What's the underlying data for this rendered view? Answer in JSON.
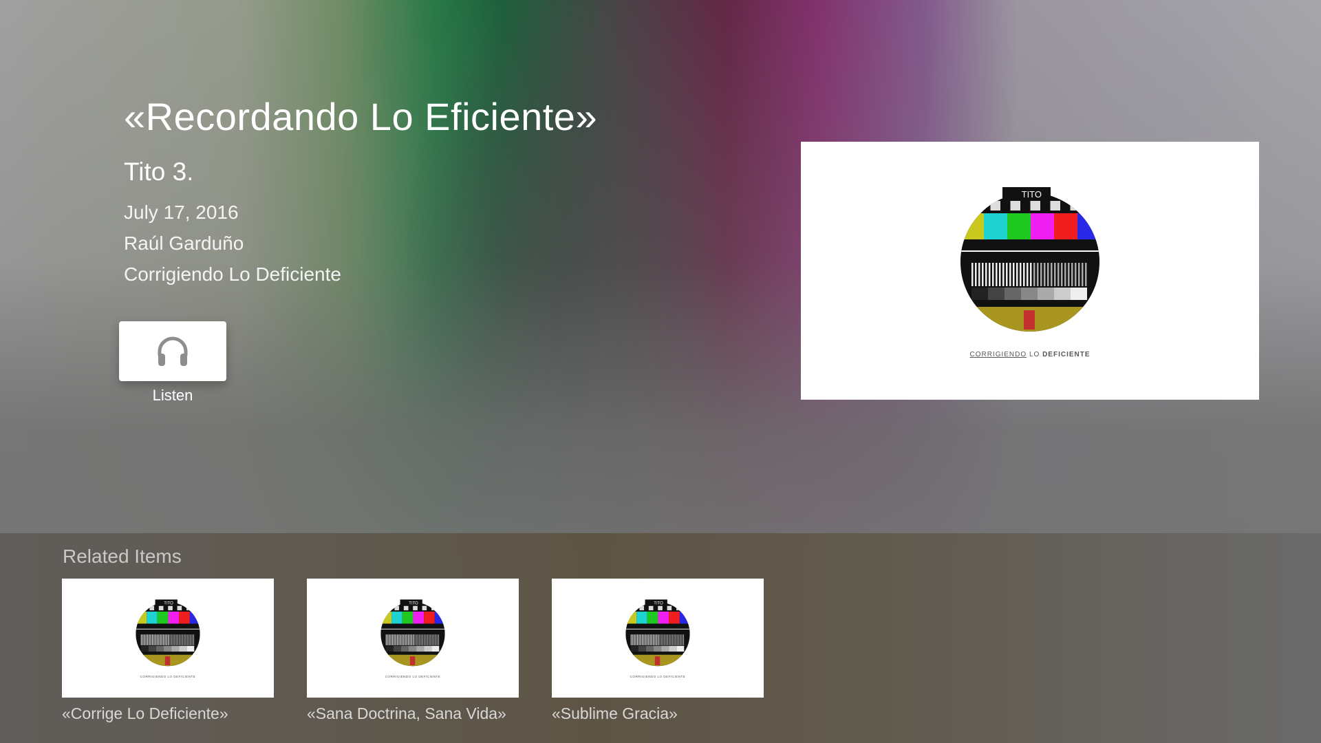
{
  "header": {
    "title": "«Recordando Lo Eficiente»",
    "subtitle": "Tito 3.",
    "date": "July 17, 2016",
    "author": "Raúl Garduño",
    "series": "Corrigiendo Lo Deficiente"
  },
  "actions": {
    "listen_label": "Listen",
    "listen_icon": "headphones-icon"
  },
  "artwork": {
    "badge": "TITO",
    "caption_prefix": "CORRIGIENDO",
    "caption_mid": "LO",
    "caption_suffix": "DEFICIENTE"
  },
  "related": {
    "title": "Related Items",
    "items": [
      {
        "label": "«Corrige Lo Deficiente»"
      },
      {
        "label": "«Sana Doctrina, Sana Vida»"
      },
      {
        "label": "«Sublime Gracia»"
      }
    ]
  },
  "colors": {
    "bar_colors": [
      "#c8c81e",
      "#1ed2d2",
      "#1ec81e",
      "#f01ef0",
      "#f01e1e",
      "#2828e6"
    ]
  }
}
